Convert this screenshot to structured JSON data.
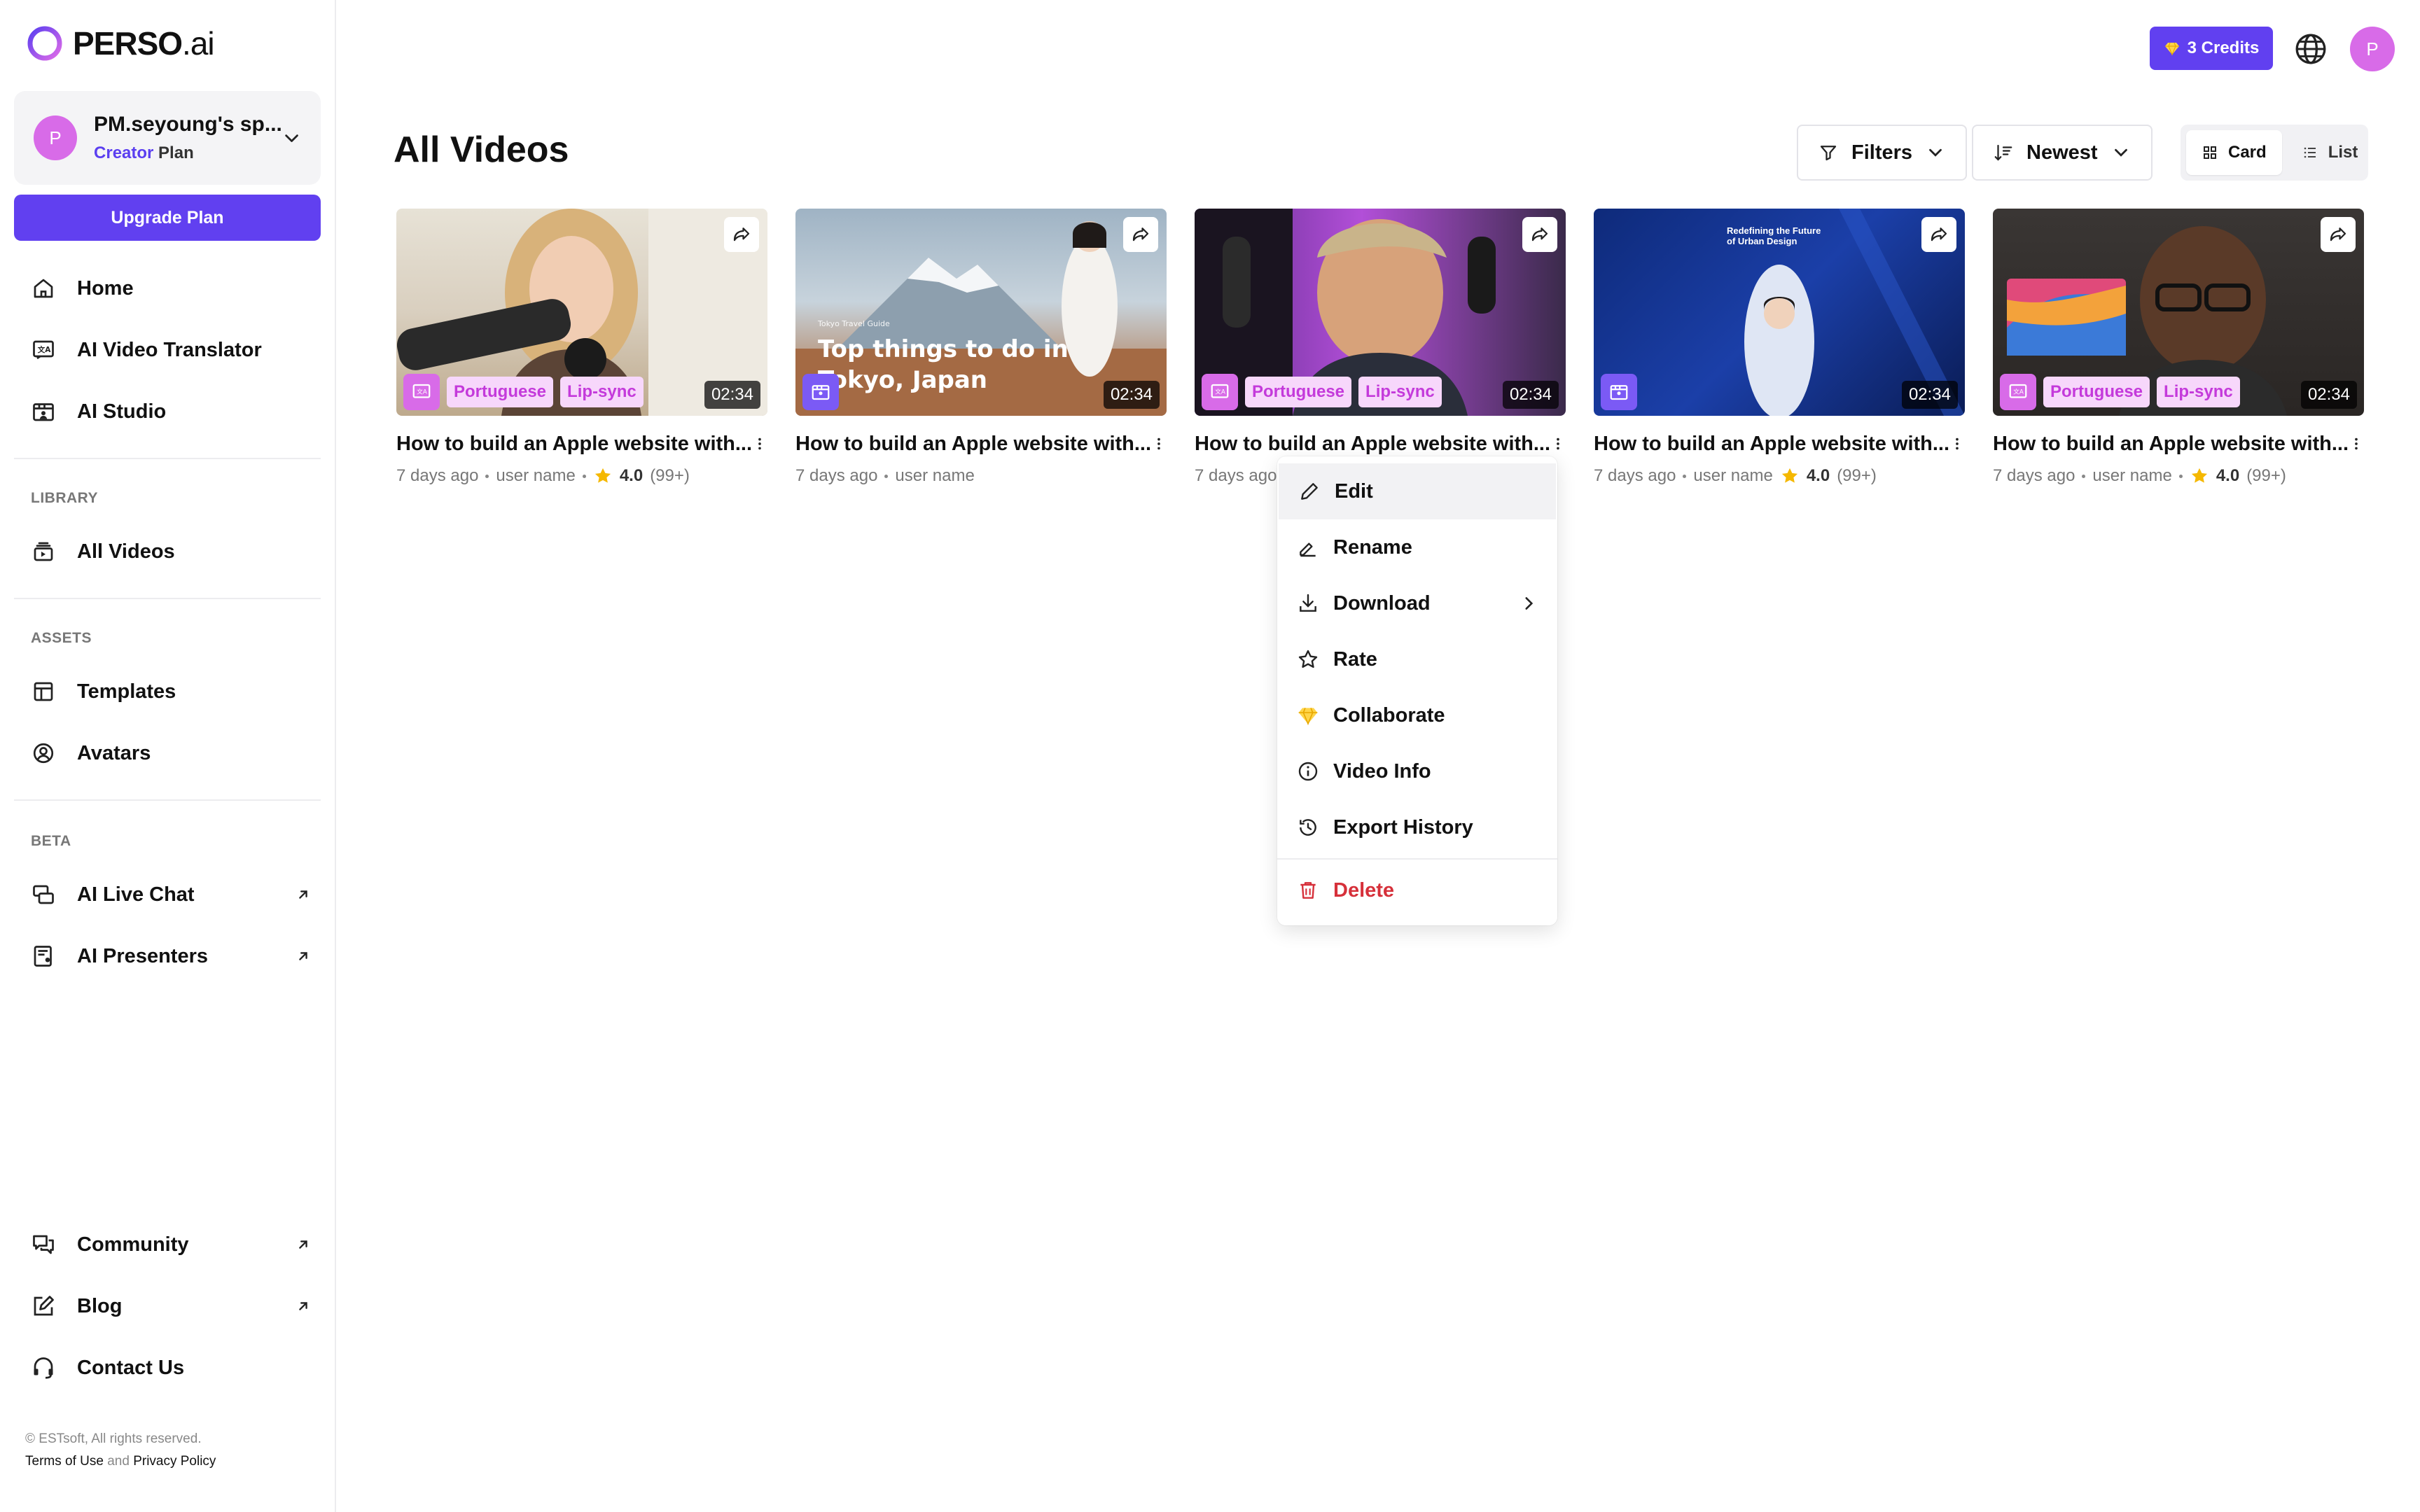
{
  "brand": {
    "logo_text": "PERSO",
    "logo_suffix": ".ai"
  },
  "account": {
    "avatar_initial": "P",
    "name": "PM.seyoung's sp...",
    "plan_tier": "Creator",
    "plan_suffix": "Plan"
  },
  "sidebar": {
    "upgrade_label": "Upgrade Plan",
    "main": [
      {
        "label": "Home",
        "icon": "home-icon"
      },
      {
        "label": "AI Video Translator",
        "icon": "translate-icon"
      },
      {
        "label": "AI Studio",
        "icon": "studio-icon"
      }
    ],
    "library_label": "LIBRARY",
    "library": [
      {
        "label": "All Videos",
        "icon": "videos-icon"
      }
    ],
    "assets_label": "ASSETS",
    "assets": [
      {
        "label": "Templates",
        "icon": "templates-icon"
      },
      {
        "label": "Avatars",
        "icon": "avatar-icon"
      }
    ],
    "beta_label": "BETA",
    "beta": [
      {
        "label": "AI Live Chat",
        "icon": "live-chat-icon"
      },
      {
        "label": "AI Presenters",
        "icon": "presenters-icon"
      }
    ],
    "bottom": [
      {
        "label": "Community",
        "icon": "community-icon"
      },
      {
        "label": "Blog",
        "icon": "blog-icon"
      },
      {
        "label": "Contact Us",
        "icon": "headset-icon"
      }
    ],
    "footer": {
      "copyright": "© ESTsoft, All rights reserved.",
      "terms": "Terms of Use",
      "and": "and",
      "privacy": "Privacy Policy"
    }
  },
  "topbar": {
    "credits_label": "3 Credits",
    "avatar_initial": "P"
  },
  "header": {
    "title": "All Videos",
    "filters_label": "Filters",
    "sort_label": "Newest",
    "view_card_label": "Card",
    "view_list_label": "List"
  },
  "cards": [
    {
      "title": "How to build an Apple website with...",
      "type": "translate",
      "tags": [
        "Portuguese",
        "Lip-sync"
      ],
      "duration": "02:34",
      "age": "7 days ago",
      "user": "user name",
      "rating": "4.0",
      "rating_count": "(99+)"
    },
    {
      "title": "How to build an Apple website with...",
      "type": "studio",
      "tags": [],
      "duration": "02:34",
      "age": "7 days ago",
      "user": "user name",
      "overlay_small": "Tokyo Travel Guide",
      "overlay_big": "Top things to do in Tokyo, Japan"
    },
    {
      "title": "How to build an Apple website with...",
      "type": "translate",
      "tags": [
        "Portuguese",
        "Lip-sync"
      ],
      "duration": "02:34",
      "age": "7 days ago"
    },
    {
      "title": "How to build an Apple website with...",
      "type": "studio",
      "tags": [],
      "duration": "02:34",
      "age": "7 days ago",
      "user": "user name",
      "rating": "4.0",
      "rating_count": "(99+)",
      "slide_title": "Redefining the Future of Urban Design"
    },
    {
      "title": "How to build an Apple website with...",
      "type": "translate",
      "tags": [
        "Portuguese",
        "Lip-sync"
      ],
      "duration": "02:34",
      "age": "7 days ago",
      "user": "user name",
      "rating": "4.0",
      "rating_count": "(99+)"
    }
  ],
  "context_menu": {
    "items": [
      {
        "label": "Edit",
        "icon": "pencil-icon"
      },
      {
        "label": "Rename",
        "icon": "rename-icon"
      },
      {
        "label": "Download",
        "icon": "download-icon"
      },
      {
        "label": "Rate",
        "icon": "star-icon"
      },
      {
        "label": "Collaborate",
        "icon": "diamond-icon"
      },
      {
        "label": "Video Info",
        "icon": "info-icon"
      },
      {
        "label": "Export History",
        "icon": "history-icon"
      }
    ],
    "delete_label": "Delete"
  },
  "colors": {
    "accent": "#6140f0",
    "avatar": "#d86be8",
    "tag_bg": "#f7d7fb",
    "tag_text": "#c43adb",
    "danger": "#d6303a",
    "star": "#f5b800"
  }
}
